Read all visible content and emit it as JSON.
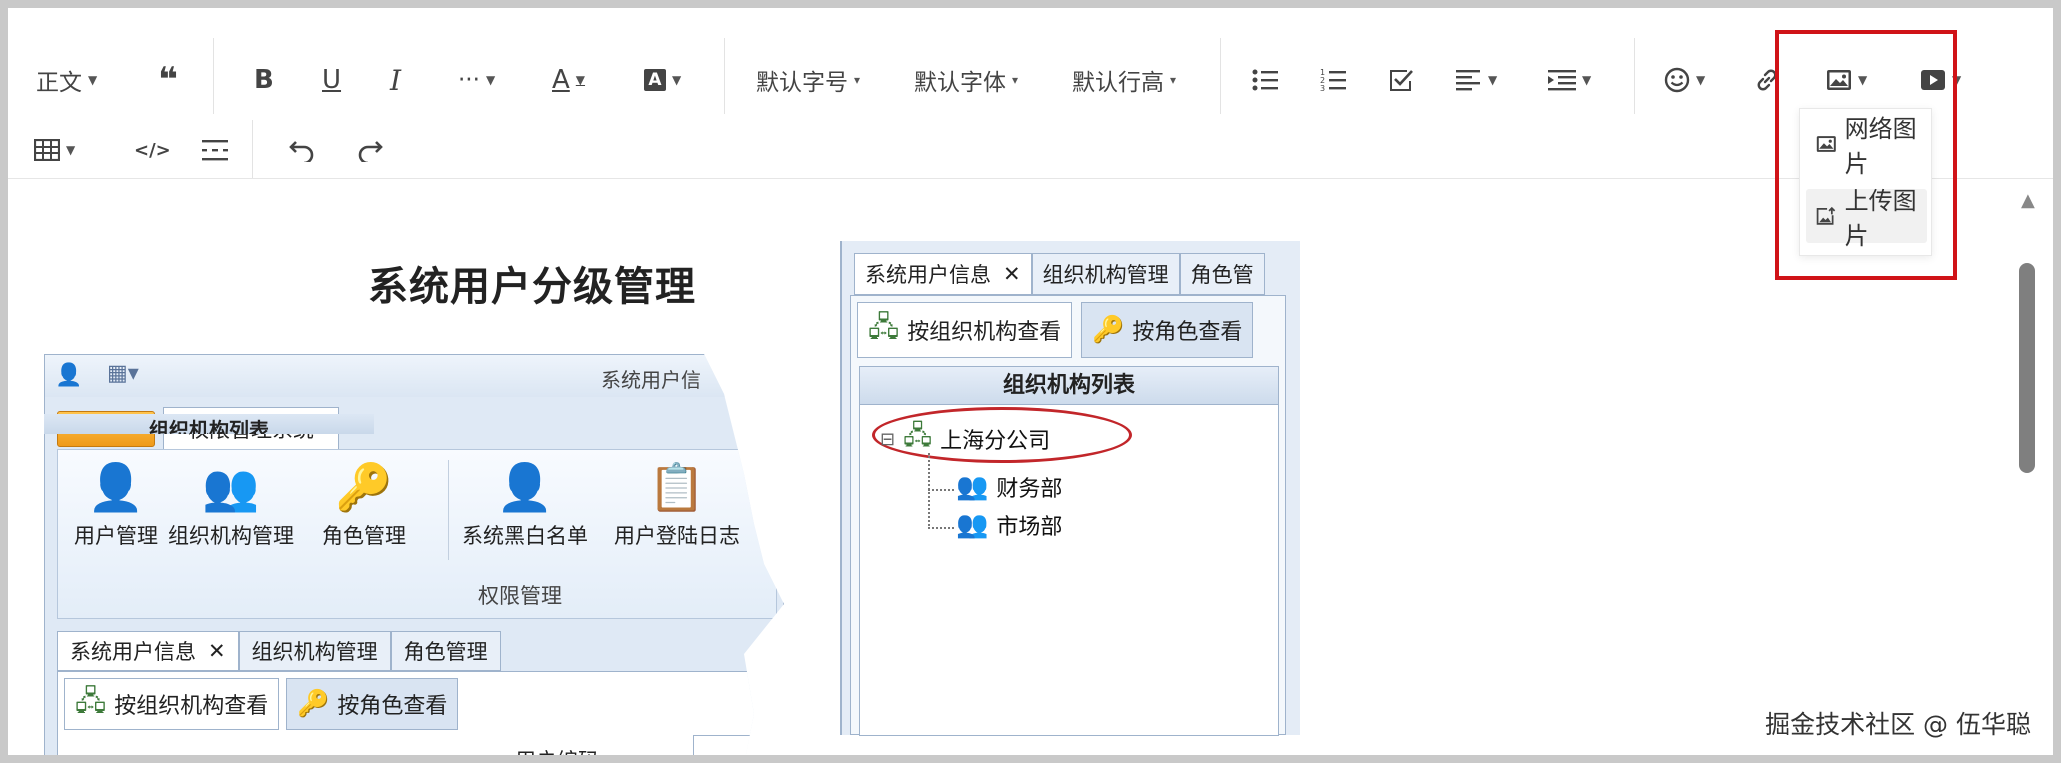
{
  "toolbar": {
    "paragraph_label": "正文",
    "font_size_label": "默认字号",
    "font_family_label": "默认字体",
    "line_height_label": "默认行高",
    "more_label": "···"
  },
  "image_menu": {
    "items": [
      {
        "label": "网络图片"
      },
      {
        "label": "上传图片"
      }
    ]
  },
  "content": {
    "left_image": {
      "title": "系统用户分级管理",
      "window_title": "系统用户信",
      "ribbon_tab": "权限管理系统",
      "ribbon_buttons": [
        {
          "label": "用户管理"
        },
        {
          "label": "组织机构管理"
        },
        {
          "label": "角色管理"
        },
        {
          "label": "系统黑白名单"
        },
        {
          "label": "用户登陆日志"
        }
      ],
      "ribbon_group": "权限管理",
      "tabs": [
        {
          "label": "系统用户信息",
          "close": "✕"
        },
        {
          "label": "组织机构管理"
        },
        {
          "label": "角色管理"
        }
      ],
      "subtabs": [
        {
          "label": "按组织机构查看"
        },
        {
          "label": "按角色查看"
        }
      ],
      "field_label": "用户编码",
      "list_header": "组织机构列表"
    },
    "right_image": {
      "tabs": [
        {
          "label": "系统用户信息",
          "close": "✕"
        },
        {
          "label": "组织机构管理"
        },
        {
          "label": "角色管"
        }
      ],
      "subtabs": [
        {
          "label": "按组织机构查看"
        },
        {
          "label": "按角色查看"
        }
      ],
      "list_header": "组织机构列表",
      "tree": {
        "root": "上海分公司",
        "expander": "⊟",
        "children": [
          "财务部",
          "市场部"
        ]
      }
    }
  },
  "watermark": "掘金技术社区 @ 伍华聪",
  "colors": {
    "highlight": "#d01318",
    "toolbar_icon": "#444444",
    "scrollbar": "#7f7f7f"
  }
}
